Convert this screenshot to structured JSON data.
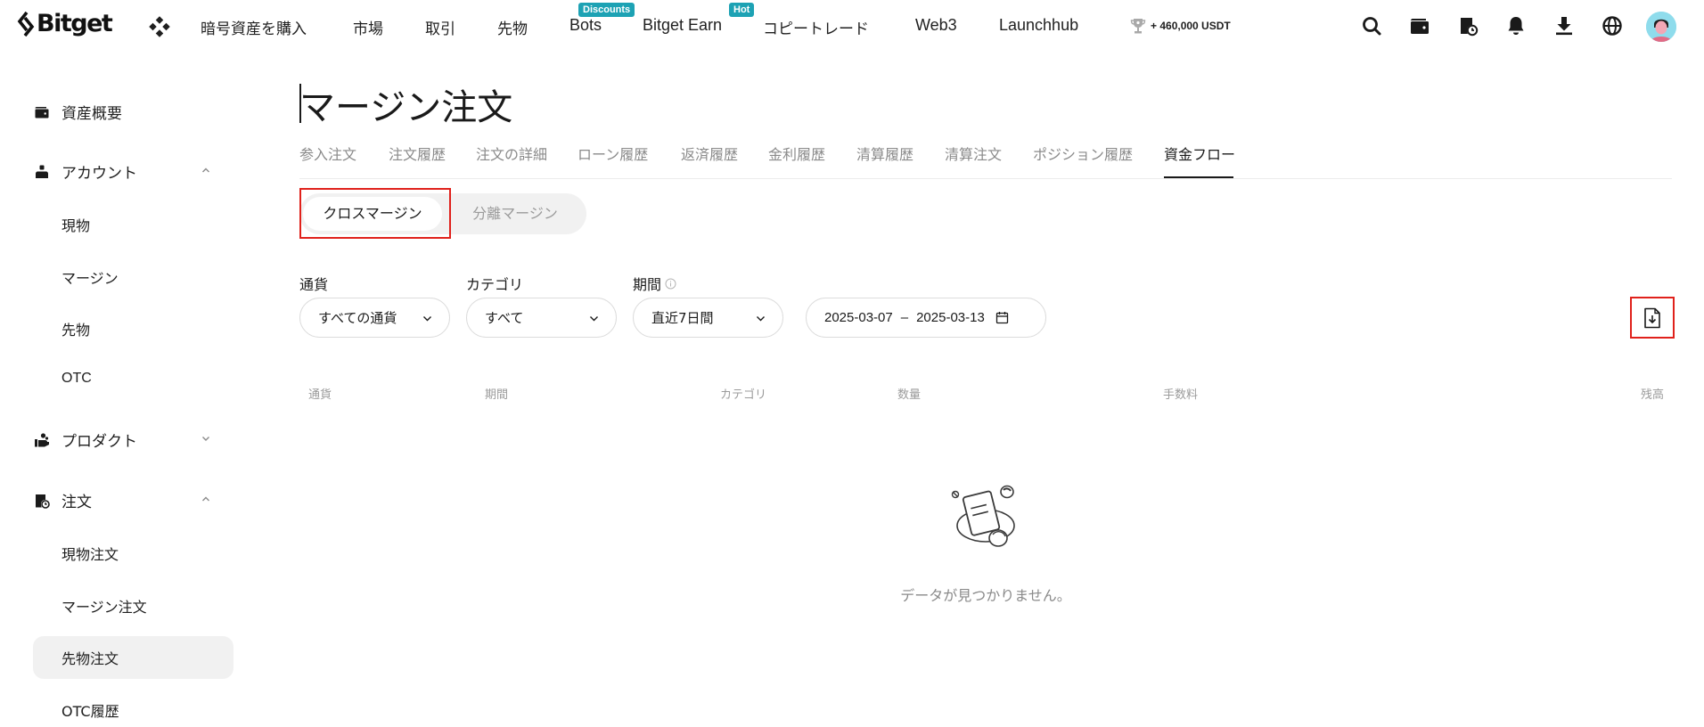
{
  "header": {
    "logo_text": "Bitget",
    "nav": [
      {
        "label": "暗号資産を購入"
      },
      {
        "label": "市場"
      },
      {
        "label": "取引"
      },
      {
        "label": "先物"
      },
      {
        "label": "Bots",
        "badge": "Discounts"
      },
      {
        "label": "Bitget Earn",
        "badge": "Hot"
      },
      {
        "label": "コピートレード"
      },
      {
        "label": "Web3"
      },
      {
        "label": "Launchhub"
      }
    ],
    "promo": "+ 460,000 USDT",
    "icons": [
      "search-icon",
      "wallet-icon",
      "orders-icon",
      "bell-icon",
      "download-icon",
      "globe-icon"
    ]
  },
  "sidebar": {
    "items": [
      {
        "label": "資産概要",
        "icon": "wallet-icon"
      },
      {
        "label": "アカウント",
        "icon": "user-icon",
        "expanded": true
      },
      {
        "label": "現物"
      },
      {
        "label": "マージン"
      },
      {
        "label": "先物"
      },
      {
        "label": "OTC"
      },
      {
        "label": "プロダクト",
        "icon": "product-icon",
        "expanded": false
      },
      {
        "label": "注文",
        "icon": "orders-icon",
        "expanded": true
      },
      {
        "label": "現物注文"
      },
      {
        "label": "マージン注文",
        "active": true
      },
      {
        "label": "先物注文"
      },
      {
        "label": "OTC履歴"
      }
    ]
  },
  "main": {
    "title": "マージン注文",
    "tabs": [
      {
        "label": "参入注文"
      },
      {
        "label": "注文履歴"
      },
      {
        "label": "注文の詳細"
      },
      {
        "label": "ローン履歴"
      },
      {
        "label": "返済履歴"
      },
      {
        "label": "金利履歴"
      },
      {
        "label": "清算履歴"
      },
      {
        "label": "清算注文"
      },
      {
        "label": "ポジション履歴"
      },
      {
        "label": "資金フロー",
        "active": true
      }
    ],
    "segments": [
      {
        "label": "クロスマージン",
        "active": true
      },
      {
        "label": "分離マージン",
        "active": false
      }
    ],
    "filters": {
      "currency": {
        "label": "通貨",
        "value": "すべての通貨"
      },
      "category": {
        "label": "カテゴリ",
        "value": "すべて"
      },
      "period": {
        "label": "期間",
        "value": "直近7日間"
      },
      "date_start": "2025-03-07",
      "date_sep": "–",
      "date_end": "2025-03-13"
    },
    "table_headers": [
      "通貨",
      "期間",
      "カテゴリ",
      "数量",
      "手数料",
      "残高"
    ],
    "empty_text": "データが見つかりません。"
  },
  "colors": {
    "text": "#1f1f1f",
    "muted": "#8a8a8a",
    "badge": "#1da2b4",
    "highlight": "#e0211b",
    "segment_bg": "#f1f1f1"
  }
}
